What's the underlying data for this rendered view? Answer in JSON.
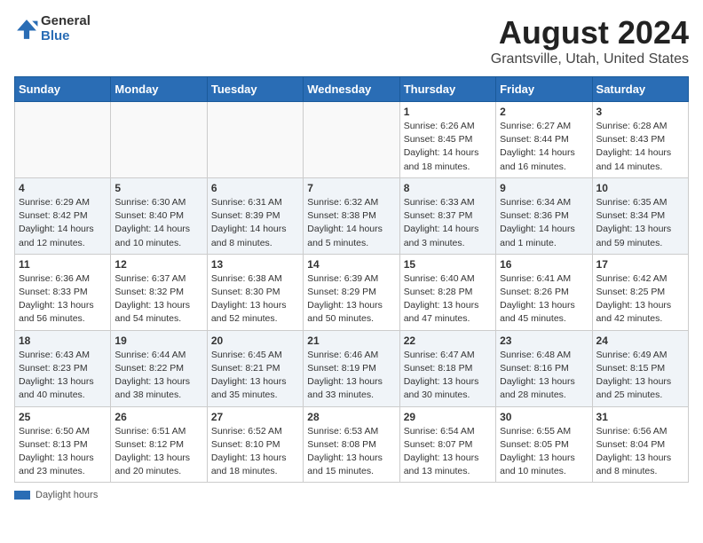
{
  "logo": {
    "general": "General",
    "blue": "Blue"
  },
  "title": "August 2024",
  "subtitle": "Grantsville, Utah, United States",
  "days_header": [
    "Sunday",
    "Monday",
    "Tuesday",
    "Wednesday",
    "Thursday",
    "Friday",
    "Saturday"
  ],
  "weeks": [
    [
      {
        "day": "",
        "info": ""
      },
      {
        "day": "",
        "info": ""
      },
      {
        "day": "",
        "info": ""
      },
      {
        "day": "",
        "info": ""
      },
      {
        "day": "1",
        "info": "Sunrise: 6:26 AM\nSunset: 8:45 PM\nDaylight: 14 hours\nand 18 minutes."
      },
      {
        "day": "2",
        "info": "Sunrise: 6:27 AM\nSunset: 8:44 PM\nDaylight: 14 hours\nand 16 minutes."
      },
      {
        "day": "3",
        "info": "Sunrise: 6:28 AM\nSunset: 8:43 PM\nDaylight: 14 hours\nand 14 minutes."
      }
    ],
    [
      {
        "day": "4",
        "info": "Sunrise: 6:29 AM\nSunset: 8:42 PM\nDaylight: 14 hours\nand 12 minutes."
      },
      {
        "day": "5",
        "info": "Sunrise: 6:30 AM\nSunset: 8:40 PM\nDaylight: 14 hours\nand 10 minutes."
      },
      {
        "day": "6",
        "info": "Sunrise: 6:31 AM\nSunset: 8:39 PM\nDaylight: 14 hours\nand 8 minutes."
      },
      {
        "day": "7",
        "info": "Sunrise: 6:32 AM\nSunset: 8:38 PM\nDaylight: 14 hours\nand 5 minutes."
      },
      {
        "day": "8",
        "info": "Sunrise: 6:33 AM\nSunset: 8:37 PM\nDaylight: 14 hours\nand 3 minutes."
      },
      {
        "day": "9",
        "info": "Sunrise: 6:34 AM\nSunset: 8:36 PM\nDaylight: 14 hours\nand 1 minute."
      },
      {
        "day": "10",
        "info": "Sunrise: 6:35 AM\nSunset: 8:34 PM\nDaylight: 13 hours\nand 59 minutes."
      }
    ],
    [
      {
        "day": "11",
        "info": "Sunrise: 6:36 AM\nSunset: 8:33 PM\nDaylight: 13 hours\nand 56 minutes."
      },
      {
        "day": "12",
        "info": "Sunrise: 6:37 AM\nSunset: 8:32 PM\nDaylight: 13 hours\nand 54 minutes."
      },
      {
        "day": "13",
        "info": "Sunrise: 6:38 AM\nSunset: 8:30 PM\nDaylight: 13 hours\nand 52 minutes."
      },
      {
        "day": "14",
        "info": "Sunrise: 6:39 AM\nSunset: 8:29 PM\nDaylight: 13 hours\nand 50 minutes."
      },
      {
        "day": "15",
        "info": "Sunrise: 6:40 AM\nSunset: 8:28 PM\nDaylight: 13 hours\nand 47 minutes."
      },
      {
        "day": "16",
        "info": "Sunrise: 6:41 AM\nSunset: 8:26 PM\nDaylight: 13 hours\nand 45 minutes."
      },
      {
        "day": "17",
        "info": "Sunrise: 6:42 AM\nSunset: 8:25 PM\nDaylight: 13 hours\nand 42 minutes."
      }
    ],
    [
      {
        "day": "18",
        "info": "Sunrise: 6:43 AM\nSunset: 8:23 PM\nDaylight: 13 hours\nand 40 minutes."
      },
      {
        "day": "19",
        "info": "Sunrise: 6:44 AM\nSunset: 8:22 PM\nDaylight: 13 hours\nand 38 minutes."
      },
      {
        "day": "20",
        "info": "Sunrise: 6:45 AM\nSunset: 8:21 PM\nDaylight: 13 hours\nand 35 minutes."
      },
      {
        "day": "21",
        "info": "Sunrise: 6:46 AM\nSunset: 8:19 PM\nDaylight: 13 hours\nand 33 minutes."
      },
      {
        "day": "22",
        "info": "Sunrise: 6:47 AM\nSunset: 8:18 PM\nDaylight: 13 hours\nand 30 minutes."
      },
      {
        "day": "23",
        "info": "Sunrise: 6:48 AM\nSunset: 8:16 PM\nDaylight: 13 hours\nand 28 minutes."
      },
      {
        "day": "24",
        "info": "Sunrise: 6:49 AM\nSunset: 8:15 PM\nDaylight: 13 hours\nand 25 minutes."
      }
    ],
    [
      {
        "day": "25",
        "info": "Sunrise: 6:50 AM\nSunset: 8:13 PM\nDaylight: 13 hours\nand 23 minutes."
      },
      {
        "day": "26",
        "info": "Sunrise: 6:51 AM\nSunset: 8:12 PM\nDaylight: 13 hours\nand 20 minutes."
      },
      {
        "day": "27",
        "info": "Sunrise: 6:52 AM\nSunset: 8:10 PM\nDaylight: 13 hours\nand 18 minutes."
      },
      {
        "day": "28",
        "info": "Sunrise: 6:53 AM\nSunset: 8:08 PM\nDaylight: 13 hours\nand 15 minutes."
      },
      {
        "day": "29",
        "info": "Sunrise: 6:54 AM\nSunset: 8:07 PM\nDaylight: 13 hours\nand 13 minutes."
      },
      {
        "day": "30",
        "info": "Sunrise: 6:55 AM\nSunset: 8:05 PM\nDaylight: 13 hours\nand 10 minutes."
      },
      {
        "day": "31",
        "info": "Sunrise: 6:56 AM\nSunset: 8:04 PM\nDaylight: 13 hours\nand 8 minutes."
      }
    ]
  ],
  "footer": {
    "label": "Daylight hours"
  }
}
